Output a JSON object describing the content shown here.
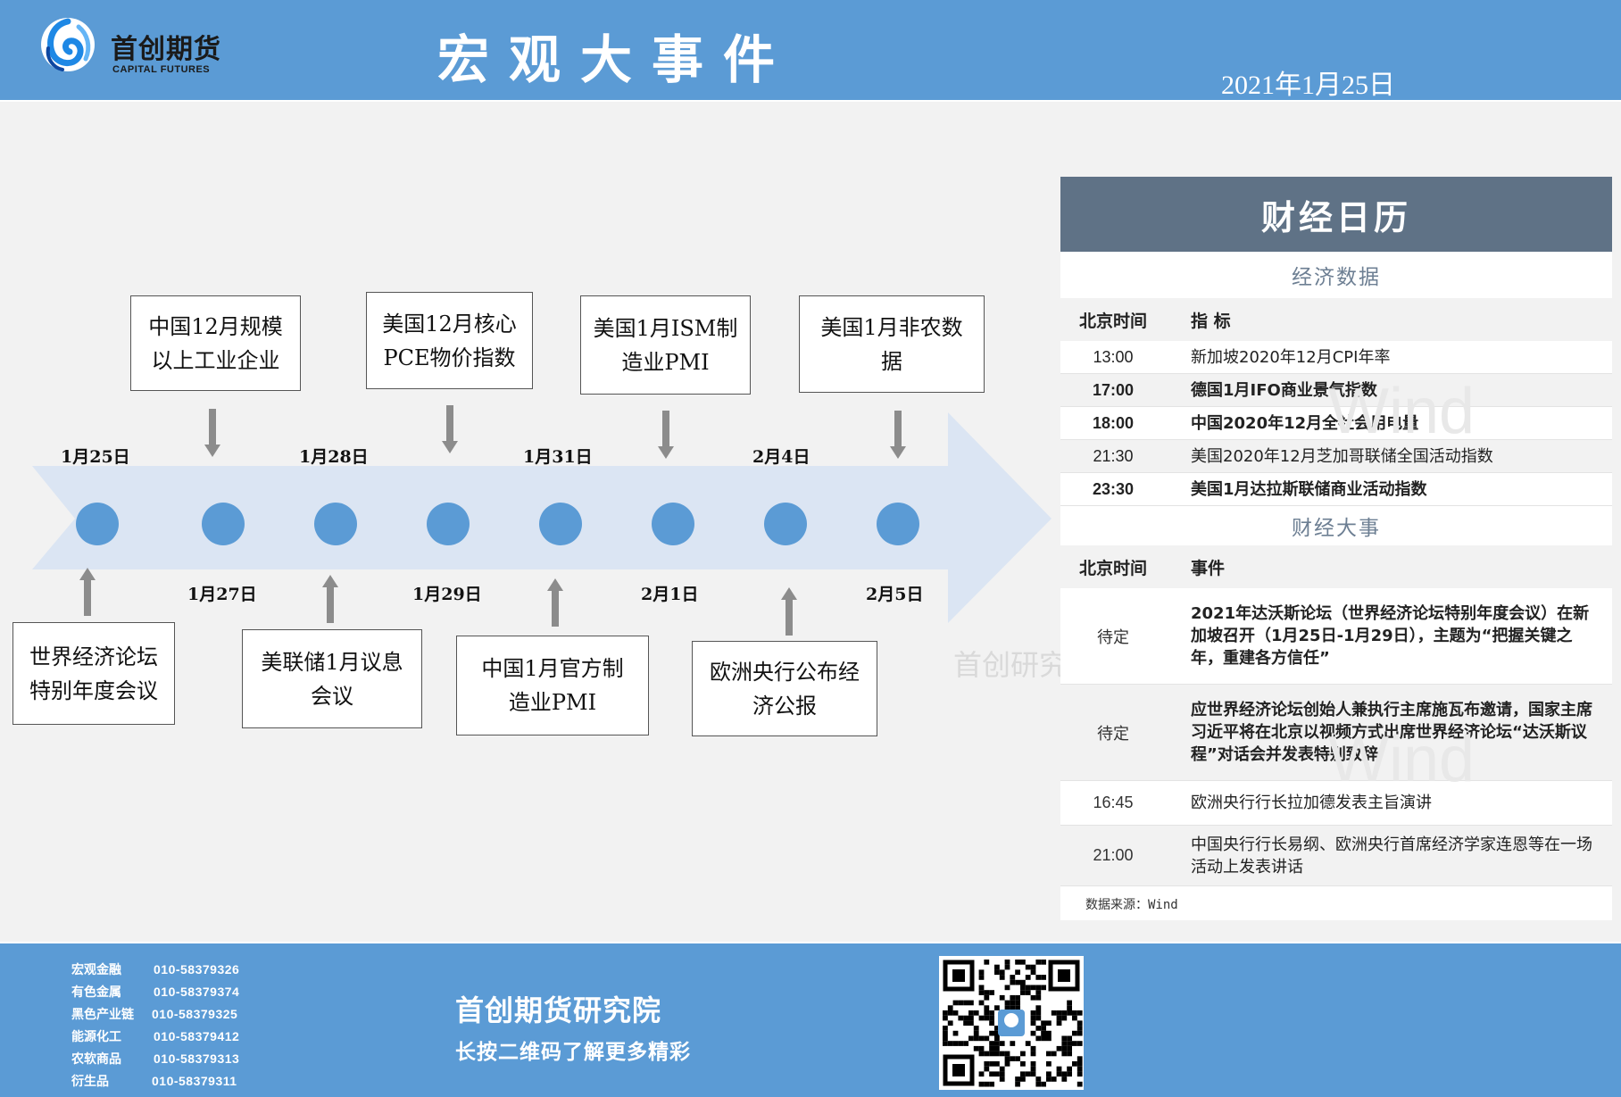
{
  "header": {
    "logo_cn": "首创期货",
    "logo_en": "CAPITAL FUTURES",
    "title": "宏观大事件",
    "date": "2021年1月25日"
  },
  "timeline": {
    "dates_top": [
      "1月25日",
      "1月28日",
      "1月31日",
      "2月4日"
    ],
    "dates_bottom": [
      "1月27日",
      "1月29日",
      "2月1日",
      "2月5日"
    ],
    "events_top": [
      [
        "中国12月规模",
        "以上工业企业"
      ],
      [
        "美国12月核心",
        "PCE物价指数"
      ],
      [
        "美国1月ISM制",
        "造业PMI"
      ],
      [
        "美国1月非农数",
        "据"
      ]
    ],
    "events_bottom": [
      [
        "世界经济论坛",
        "特别年度会议"
      ],
      [
        "美联储1月议息",
        "会议"
      ],
      [
        "中国1月官方制",
        "造业PMI"
      ],
      [
        "欧洲央行公布经",
        "济公报"
      ]
    ],
    "watermark": "首创研究"
  },
  "calendar": {
    "title": "财经日历",
    "section_data": "经济数据",
    "section_events": "财经大事",
    "col_time": "北京时间",
    "col_indicator": "指 标",
    "col_event": "事件",
    "data_rows": [
      {
        "time": "13:00",
        "text": "新加坡2020年12月CPI年率"
      },
      {
        "time": "17:00",
        "text": "德国1月IFO商业景气指数"
      },
      {
        "time": "18:00",
        "text": "中国2020年12月全社会用电量"
      },
      {
        "time": "21:30",
        "text": "美国2020年12月芝加哥联储全国活动指数"
      },
      {
        "time": "23:30",
        "text": "美国1月达拉斯联储商业活动指数"
      }
    ],
    "event_rows": [
      {
        "time": "待定",
        "text": "2021年达沃斯论坛（世界经济论坛特别年度会议）在新加坡召开（1月25日-1月29日），主题为“把握关键之年，重建各方信任”"
      },
      {
        "time": "待定",
        "text": "应世界经济论坛创始人兼执行主席施瓦布邀请，国家主席习近平将在北京以视频方式出席世界经济论坛“达沃斯议程”对话会并发表特别致辞"
      },
      {
        "time": "16:45",
        "text": "欧洲央行行长拉加德发表主旨演讲"
      },
      {
        "time": "21:00",
        "text": "中国央行行长易纲、欧洲央行首席经济学家连恩等在一场活动上发表讲话"
      }
    ],
    "source": "数据来源：Wind",
    "watermark": "Wind"
  },
  "footer": {
    "contacts": [
      {
        "dept": "宏观金融",
        "phone": "010-58379326"
      },
      {
        "dept": "有色金属",
        "phone": "010-58379374"
      },
      {
        "dept": "黑色产业链",
        "phone": "010-58379325"
      },
      {
        "dept": "能源化工",
        "phone": "010-58379412"
      },
      {
        "dept": "农软商品",
        "phone": "010-58379313"
      },
      {
        "dept": "衍生品",
        "phone": "010-58379311"
      }
    ],
    "institute": "首创期货研究院",
    "slogan": "长按二维码了解更多精彩"
  },
  "colors": {
    "header_blue": "#5b9bd5",
    "arrow_blue": "#dbe5f3",
    "dot_blue": "#5b9bd5",
    "calendar_head": "#5f7286"
  }
}
